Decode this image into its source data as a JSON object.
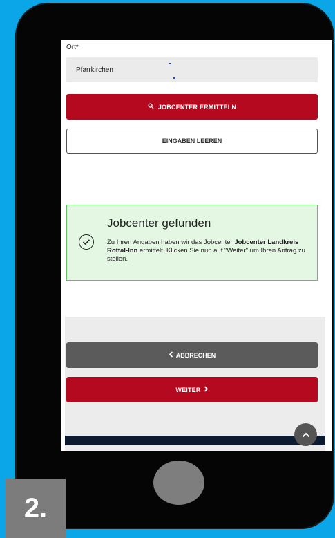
{
  "form": {
    "ort_label": "Ort*",
    "ort_value": "Pfarrkirchen",
    "search_button": "JOBCENTER ERMITTELN",
    "clear_button": "EINGABEN LEEREN"
  },
  "result": {
    "title": "Jobcenter gefunden",
    "text_before": "Zu Ihren Angaben haben wir das Jobcenter ",
    "jobcenter_name": "Jobcenter Landkreis Rottal-Inn",
    "text_after": " ermittelt. Klicken Sie nun auf \"Weiter\" um Ihren Antrag zu stellen."
  },
  "navigation": {
    "back_button": "ABBRECHEN",
    "next_button": "WEITER"
  },
  "step": {
    "label": "2."
  },
  "colors": {
    "background": "#0aa6e8",
    "primary_red": "#b5091f",
    "success_bg": "#e3f7e3",
    "success_border": "#5cc45c",
    "secondary_gray": "#5b5b5b"
  },
  "icons": {
    "search": "search-icon",
    "check": "check-circle-icon",
    "back": "chevron-left-icon",
    "next": "chevron-right-icon",
    "scroll_top": "chevron-up-icon"
  }
}
